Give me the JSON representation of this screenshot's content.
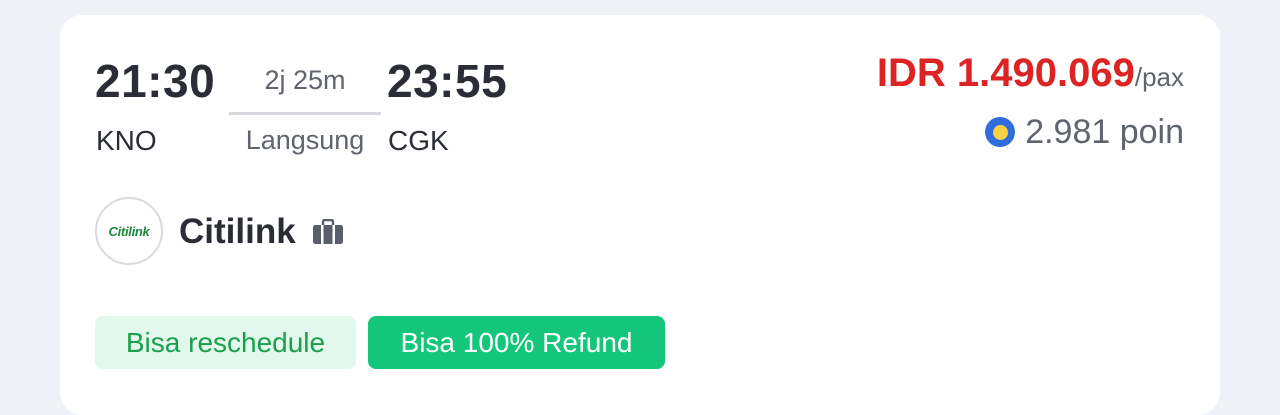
{
  "flight": {
    "departure_time": "21:30",
    "departure_code": "KNO",
    "duration": "2j 25m",
    "flight_type": "Langsung",
    "arrival_time": "23:55",
    "arrival_code": "CGK"
  },
  "pricing": {
    "price": "IDR 1.490.069",
    "per_pax": "/pax",
    "points": "2.981 poin",
    "price_color": "#dc2424"
  },
  "airline": {
    "name": "Citilink",
    "logo_text": "Citilink",
    "logo_color": "#1a8a3b",
    "baggage_icon": "baggage-icon"
  },
  "tags": {
    "reschedule": "Bisa reschedule",
    "refund": "Bisa 100% Refund"
  },
  "colors": {
    "background": "#eef1f8",
    "card": "#ffffff",
    "refund_tag": "#14c679",
    "reschedule_tag_bg": "#e2f8ec",
    "coin": "#2f6ddd"
  }
}
